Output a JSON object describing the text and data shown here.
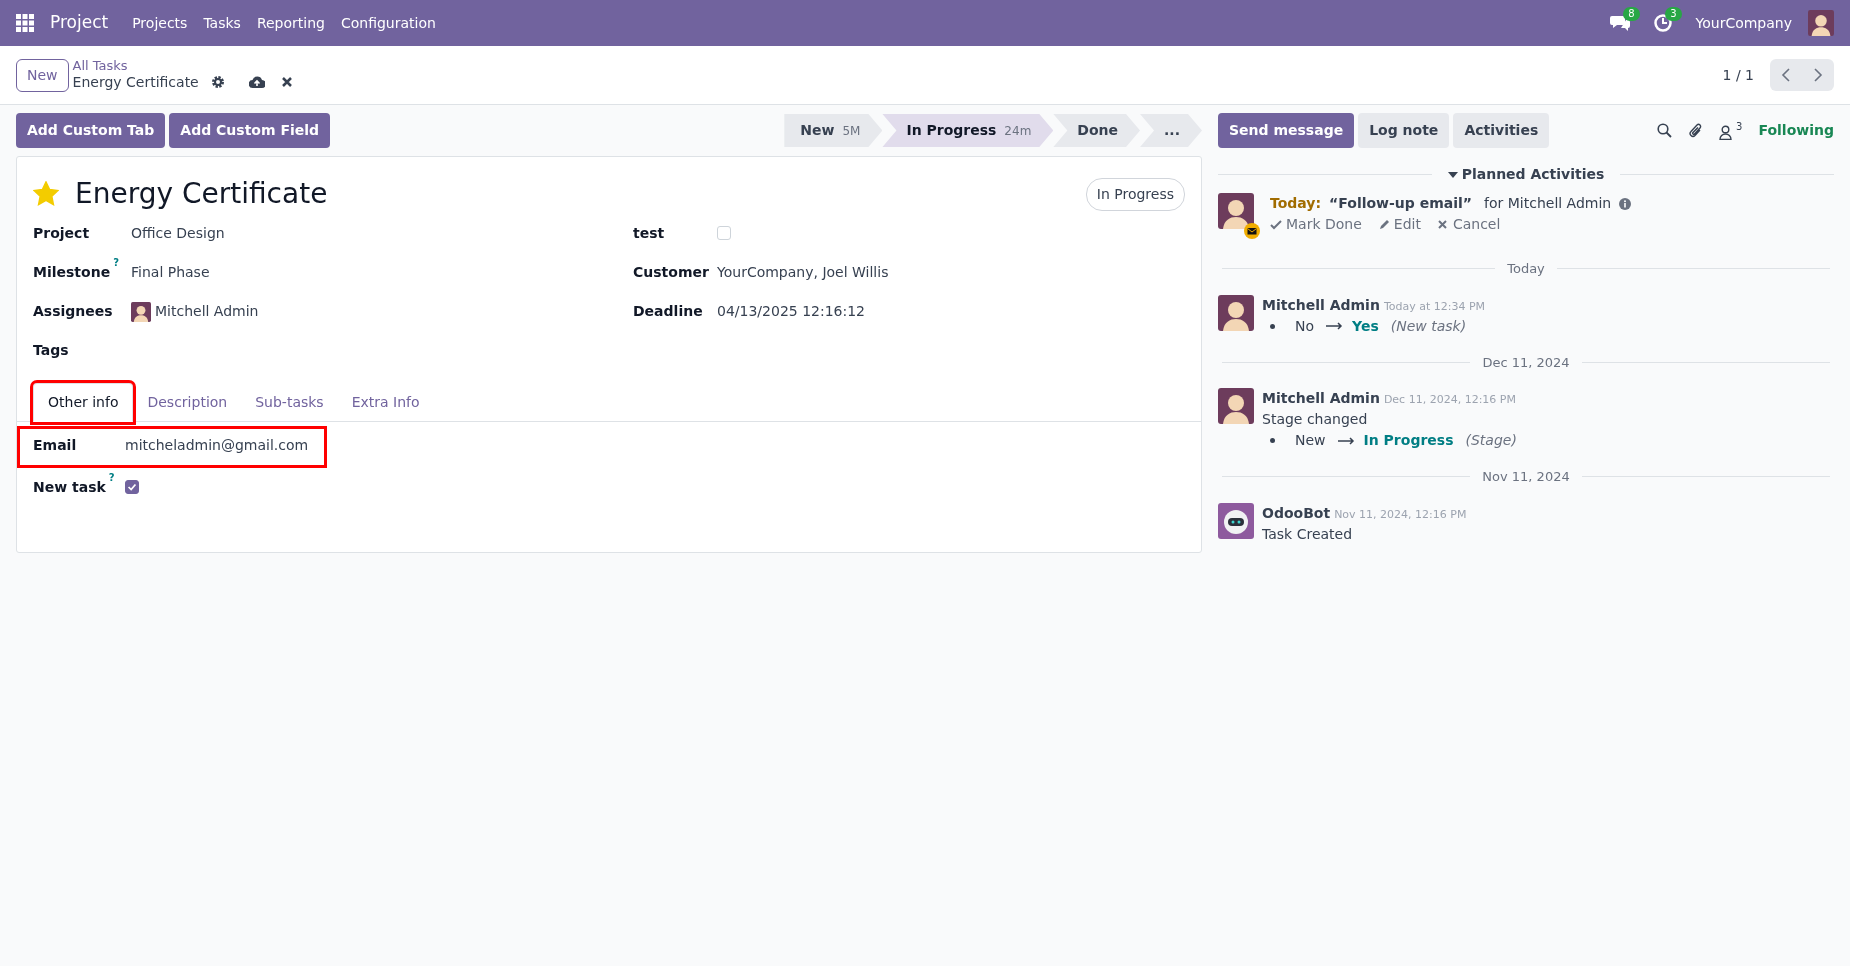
{
  "navbar": {
    "app": "Project",
    "menu": [
      "Projects",
      "Tasks",
      "Reporting",
      "Configuration"
    ],
    "messages_count": "8",
    "activities_count": "3",
    "company": "YourCompany"
  },
  "control_panel": {
    "new_button": "New",
    "breadcrumb": "All Tasks",
    "record": "Energy Certificate",
    "pager": "1 / 1"
  },
  "actions": [
    "Add Custom Tab",
    "Add Custom Field"
  ],
  "stages": [
    {
      "label": "New",
      "duration": "5M",
      "selected": false
    },
    {
      "label": "In Progress",
      "duration": "24m",
      "selected": true
    },
    {
      "label": "Done",
      "selected": false
    },
    {
      "label": "...",
      "selected": false
    }
  ],
  "chatter_buttons": [
    {
      "label": "Send message",
      "primary": true
    },
    {
      "label": "Log note",
      "primary": false
    },
    {
      "label": "Activities",
      "primary": false
    }
  ],
  "followers_count": "3",
  "follow_label": "Following",
  "form": {
    "starred": true,
    "title": "Energy Certificate",
    "status": "In Progress",
    "left_fields": [
      {
        "label": "Project",
        "value": "Office Design"
      },
      {
        "label": "Milestone",
        "help": "?",
        "value": "Final Phase"
      },
      {
        "label": "Assignees",
        "value": "Mitchell Admin",
        "kind": "user"
      },
      {
        "label": "Tags"
      }
    ],
    "right_fields": [
      {
        "label": "test",
        "kind": "checkbox",
        "checked": false
      },
      {
        "label": "Customer",
        "value": "YourCompany, Joel Willis"
      },
      {
        "label": "Deadline",
        "value": "04/13/2025 12:16:12"
      }
    ],
    "tabs": [
      {
        "label": "Other info",
        "selected": true,
        "highlighted": true
      },
      {
        "label": "Description",
        "selected": false,
        "highlighted": false
      },
      {
        "label": "Sub-tasks",
        "selected": false,
        "highlighted": false
      },
      {
        "label": "Extra Info",
        "selected": false,
        "highlighted": false
      }
    ],
    "tab_fields": [
      {
        "label": "Email",
        "value": "mitcheladmin@gmail.com",
        "highlighted": true
      },
      {
        "label": "New task",
        "help": "?",
        "kind": "checkbox",
        "checked": true,
        "highlighted": false
      }
    ]
  },
  "chatter": {
    "planned_title": "Planned Activities",
    "activity": {
      "due": "Today:",
      "summary": "“Follow-up email”",
      "assignee": "for Mitchell Admin",
      "actions": [
        "Mark Done",
        "Edit",
        "Cancel"
      ]
    },
    "groups": [
      {
        "date": "Today",
        "messages": [
          {
            "author": "Mitchell Admin",
            "kind": "user",
            "time": "Today at 12:34 PM",
            "tracking": {
              "old": "No",
              "new": "Yes",
              "field": "(New task)"
            }
          }
        ]
      },
      {
        "date": "Dec 11, 2024",
        "messages": [
          {
            "author": "Mitchell Admin",
            "kind": "user",
            "time": "Dec 11, 2024, 12:16 PM",
            "body": "Stage changed",
            "tracking": {
              "old": "New",
              "new": "In Progress",
              "field": "(Stage)"
            }
          }
        ]
      },
      {
        "date": "Nov 11, 2024",
        "messages": [
          {
            "author": "OdooBot",
            "kind": "bot",
            "time": "Nov 11, 2024, 12:16 PM",
            "body": "Task Created"
          }
        ]
      }
    ]
  }
}
